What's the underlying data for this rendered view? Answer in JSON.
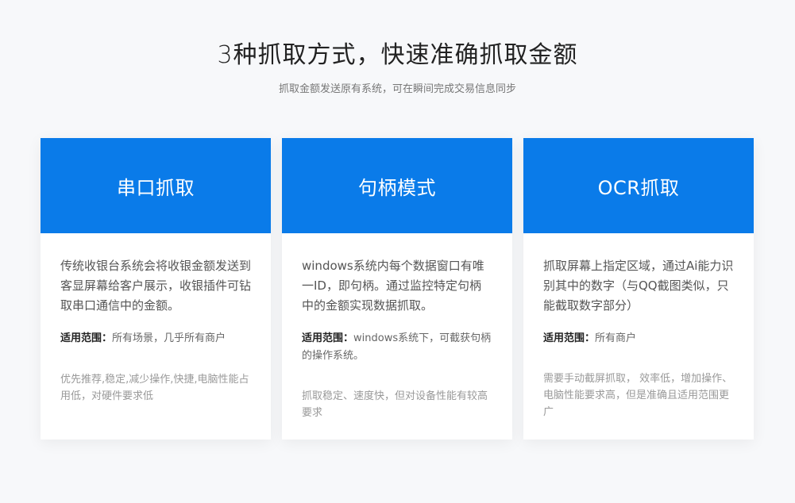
{
  "header": {
    "title": "3种抓取方式，快速准确抓取金额",
    "subtitle": "抓取金额发送原有系统，可在瞬间完成交易信息同步"
  },
  "cards": [
    {
      "title": "串口抓取",
      "description": "传统收银台系统会将收银金额发送到客显屏幕给客户展示，收银插件可钻取串口通信中的金额。",
      "scope_label": "适用范围：",
      "scope_text": "所有场景，几乎所有商户",
      "note": "优先推荐,稳定,减少操作,快捷,电脑性能占用低，对硬件要求低"
    },
    {
      "title": "句柄模式",
      "description": "windows系统内每个数据窗口有唯一ID，即句柄。通过监控特定句柄中的金额实现数据抓取。",
      "scope_label": "适用范围：",
      "scope_text": "windows系统下，可截获句柄的操作系统。",
      "note": "抓取稳定、速度快，但对设备性能有较高要求"
    },
    {
      "title": "OCR抓取",
      "description": "抓取屏幕上指定区域，通过Ai能力识别其中的数字（与QQ截图类似，只能截取数字部分）",
      "scope_label": "适用范围：",
      "scope_text": "所有商户",
      "note": "需要手动截屏抓取， 效率低，增加操作、电脑性能要求高，但是准确且适用范围更广"
    }
  ],
  "colors": {
    "accent": "#0a7be9",
    "background": "#f7f8fa"
  }
}
